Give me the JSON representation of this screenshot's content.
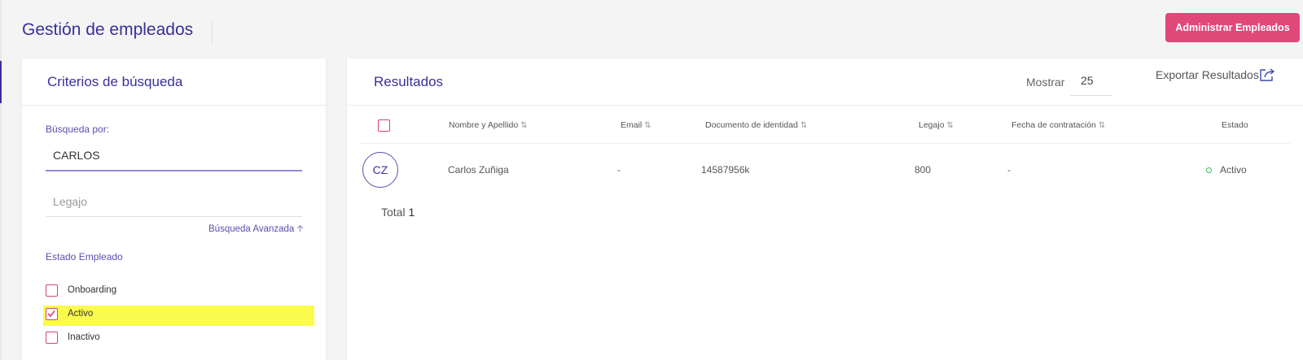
{
  "page_title": "Gestión de empleados",
  "admin_button": "Administrar Empleados",
  "search_panel": {
    "title": "Criterios de búsqueda",
    "search_by_label": "Búsqueda por:",
    "search_value": "CARLOS",
    "legajo_placeholder": "Legajo",
    "advanced_link": "Búsqueda Avanzada",
    "estado_label": "Estado Empleado",
    "estados": [
      {
        "label": "Onboarding",
        "checked": false
      },
      {
        "label": "Activo",
        "checked": true
      },
      {
        "label": "Inactivo",
        "checked": false
      }
    ]
  },
  "results": {
    "title": "Resultados",
    "show_label": "Mostrar",
    "show_value": "25",
    "export_label": "Exportar Resultados",
    "columns": [
      "Nombre y Apellido",
      "Email",
      "Documento de identidad",
      "Legajo",
      "Fecha de contratación",
      "Estado"
    ],
    "rows": [
      {
        "initials": "CZ",
        "name": "Carlos Zuñiga",
        "email": "-",
        "document": "14587956k",
        "legajo": "800",
        "hire_date": "-",
        "status": "Activo"
      }
    ],
    "total_label": "Total",
    "total_value": "1"
  },
  "colors": {
    "primary": "#3a2f9c",
    "accent": "#e0487a",
    "checkbox": "#d6417a",
    "highlight": "#fbfb4e",
    "status_active": "#3bbf58"
  }
}
